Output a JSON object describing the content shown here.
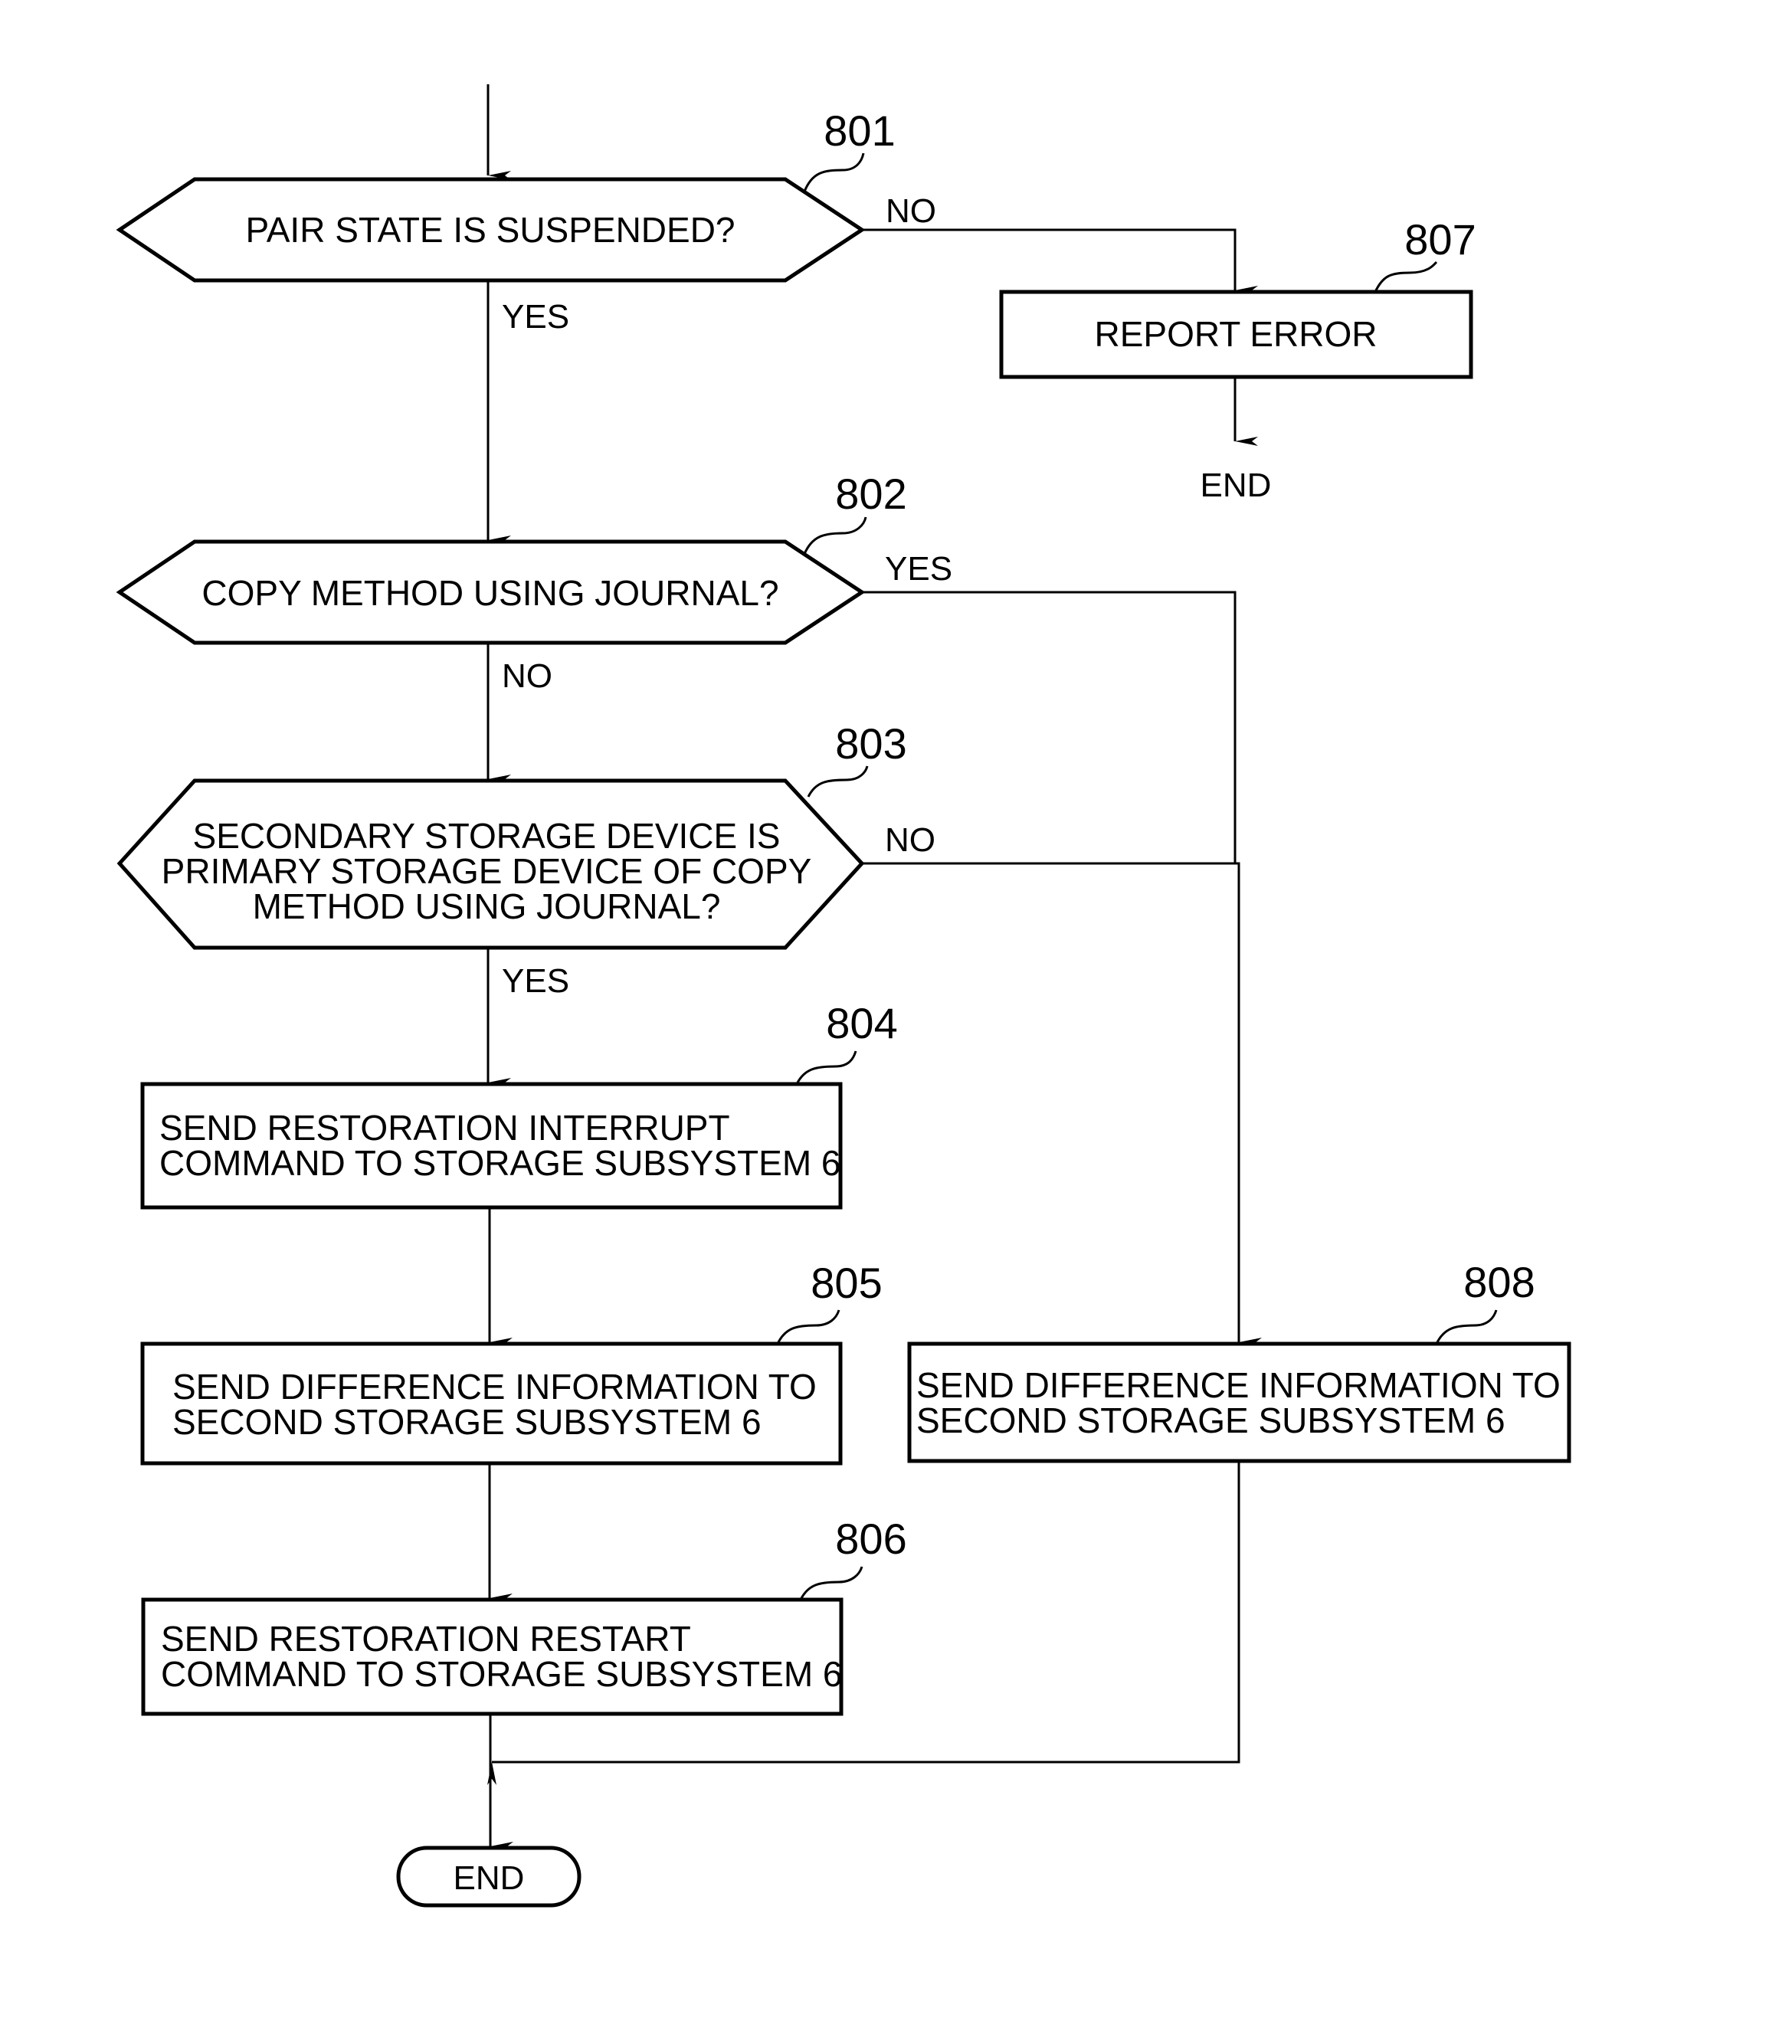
{
  "figure": {
    "steps": {
      "s801": {
        "ref": "801",
        "type": "decision",
        "lines": [
          "PAIR STATE IS SUSPENDED?"
        ],
        "yes": "YES",
        "no": "NO"
      },
      "s802": {
        "ref": "802",
        "type": "decision",
        "lines": [
          "COPY METHOD USING JOURNAL?"
        ],
        "yes": "YES",
        "no": "NO"
      },
      "s803": {
        "ref": "803",
        "type": "decision",
        "lines": [
          "SECONDARY STORAGE DEVICE IS",
          "PRIMARY STORAGE DEVICE OF COPY",
          "METHOD USING JOURNAL?"
        ],
        "yes": "YES",
        "no": "NO"
      },
      "s804": {
        "ref": "804",
        "type": "process",
        "lines": [
          "SEND RESTORATION INTERRUPT",
          "COMMAND TO STORAGE SUBSYSTEM 6"
        ]
      },
      "s805": {
        "ref": "805",
        "type": "process",
        "lines": [
          "SEND DIFFERENCE INFORMATION TO",
          "SECOND STORAGE SUBSYSTEM 6"
        ]
      },
      "s806": {
        "ref": "806",
        "type": "process",
        "lines": [
          "SEND RESTORATION RESTART",
          "COMMAND TO STORAGE SUBSYSTEM 6"
        ]
      },
      "s807": {
        "ref": "807",
        "type": "process",
        "lines": [
          "REPORT ERROR"
        ]
      },
      "s808": {
        "ref": "808",
        "type": "process",
        "lines": [
          "SEND DIFFERENCE INFORMATION TO",
          "SECOND STORAGE SUBSYSTEM 6"
        ]
      }
    },
    "end_after_error": "END",
    "end_terminal": "END"
  }
}
